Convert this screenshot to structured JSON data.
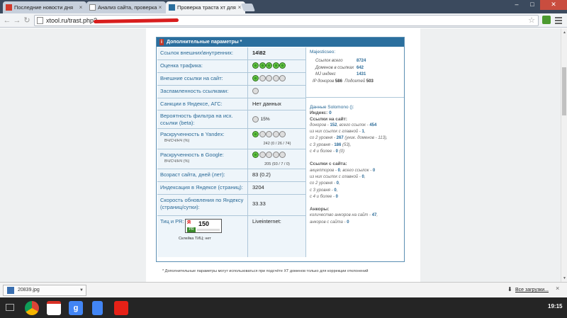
{
  "browser": {
    "tabs": [
      {
        "label": "Последние новости дня",
        "active": false
      },
      {
        "label": "Анализ сайта, проверка",
        "active": false
      },
      {
        "label": "Проверка траста хт для с",
        "active": true
      }
    ],
    "url_text": "xtool.ru/trast.php?",
    "window_controls": {
      "minimize": "–",
      "maximize": "□",
      "close": "✕"
    }
  },
  "panel": {
    "title": "Дополнительные параметры *",
    "rows": [
      {
        "label": "Ссылок внешних\\внутренних:",
        "value": "14\\82"
      },
      {
        "label": "Оценка трафика:",
        "dots_on": 5
      },
      {
        "label": "Внешние ссылки на сайт:",
        "dots_on": 1
      },
      {
        "label": "Заспамленность ссылками:",
        "dots_on": 0
      },
      {
        "label": "Санкции в Яндексе, АГС:",
        "value": "Нет данных"
      },
      {
        "label": "Вероятность фильтра на исх. ссылки (beta):",
        "value": "15%"
      },
      {
        "label": "Раскрученность в Yandex:",
        "sub": "ВЧ/СЧ/НЧ (%)",
        "dots_on": 1,
        "detail": "242 (0 / 26 / 74)"
      },
      {
        "label": "Раскрученность в Google:",
        "sub": "ВЧ/СЧ/НЧ (%)",
        "dots_on": 1,
        "detail": "205 (93 / 7 / 0)"
      },
      {
        "label": "Возраст сайта, дней (лет):",
        "value": "83 (0.2)"
      },
      {
        "label": "Индексация в Яндексе (страниц):",
        "value": "3204"
      },
      {
        "label": "Скорость обновления по Яндексу (страниц/сутки):",
        "value": "33.33"
      },
      {
        "label": "Тиц и PR:",
        "value": "Liveinternet:"
      }
    ],
    "badge": {
      "ya": "Я",
      "num": "150",
      "pr": "PR",
      "caption": "Склейка ТИЦ: нет"
    },
    "majestic": {
      "title": "Majesticseo:",
      "items": [
        {
          "k": "Ссылок всего",
          "v": "8724"
        },
        {
          "k": "Доменов в ссылках",
          "v": "642"
        },
        {
          "k": "MJ индекс",
          "v": "1431"
        }
      ],
      "ip_label": "IP доноров",
      "ip": "586",
      "subnet_label": "Подсетей",
      "subnet": "503"
    },
    "solomono": {
      "title": "Данные Solomono ():",
      "index_label": "Индекс:",
      "index": "0",
      "links_on_site": "Ссылки на сайт:",
      "donors_line": [
        "доноров - ",
        "152",
        ", всего ссылок - ",
        "454"
      ],
      "l1": [
        "из них ссылок с главной - ",
        "1",
        ","
      ],
      "l2": [
        "со 2 уровня - ",
        "267",
        " (уник. доменов - 113),"
      ],
      "l3": [
        "с 3 уровня - ",
        "186",
        " (53),"
      ],
      "l4": [
        "с 4 и более - ",
        "0",
        " (0)"
      ],
      "links_from_site": "Ссылки с сайта:",
      "acc": [
        "акцепторов - ",
        "0",
        ", всего ссылок - ",
        "0"
      ],
      "m1": [
        "из них ссылок с главной - ",
        "0",
        ","
      ],
      "m2": [
        "со 2 уровня - ",
        "0",
        ","
      ],
      "m3": [
        "с 3 уровня - ",
        "0",
        ","
      ],
      "m4": [
        "с 4 и более - ",
        "0"
      ],
      "anchors": "Анкоры:",
      "a1": [
        "количество анкоров на сайт - ",
        "47",
        ","
      ],
      "a2": [
        "анкоров с сайта - ",
        "0"
      ]
    },
    "footnote": "* Дополнительные параметры могут использоваться при подсчёте XT доменов только для коррекции отклонений"
  },
  "downloads": {
    "file": "20839.jpg",
    "all": "Все загрузки..."
  },
  "taskbar": {
    "time": "19:15"
  }
}
